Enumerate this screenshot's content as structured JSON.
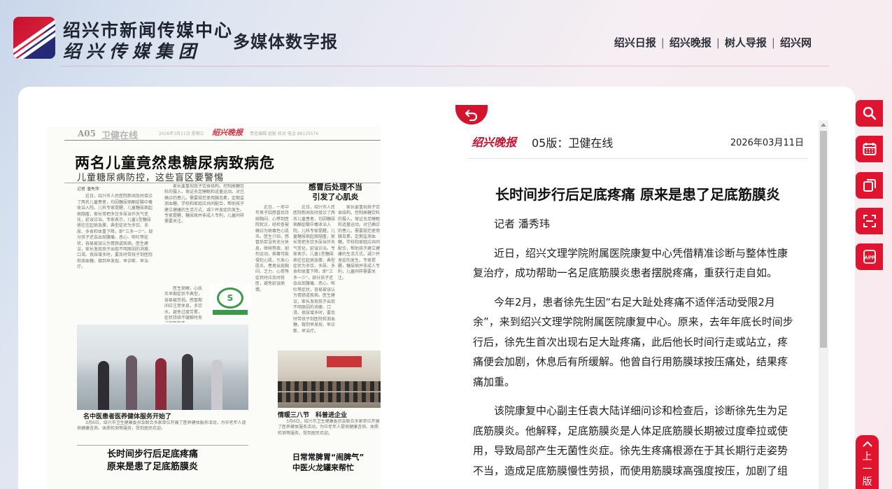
{
  "header": {
    "org_name": "绍兴市新闻传媒中心",
    "org_group": "绍兴传媒集团",
    "site_subtitle": "多媒体数字报",
    "nav": [
      "绍兴日报",
      "绍兴晚报",
      "树人导报",
      "绍兴网"
    ]
  },
  "paper": {
    "page_number": "A05",
    "section": "卫健在线",
    "meta_date": "2026年3月11日 星期三",
    "brand": "绍兴晚报",
    "editor_line": "责任编辑 组版 校对 电话 88125576",
    "main_headline": "两名儿童竟然患糖尿病致病危",
    "sub_headline": "儿童糖尿病防控，这些盲区要警惕",
    "side_headline_1": "感冒后处理不当",
    "side_headline_2": "引发了心肌炎",
    "photo1_caption": "名中医患者医养健体服务开始了",
    "photo2_caption": "情暖三八节　科普进企业",
    "bottom_headline_1a": "长时间步行后足底疼痛",
    "bottom_headline_1b": "原来是患了足底筋膜炎",
    "bottom_headline_2a": "日常常脾胃“闹脾气”",
    "bottom_headline_2b": "中医火龙罐来帮忙",
    "col1_byline": "记者 潘秀萍",
    "col1_text": "近日，绍兴市人民医院新闻及时接诊了两名儿童患者，均因糖尿病酮症酸中毒收治入院。儿科专家提醒，儿童糖尿病起病隐匿，家长常把多饮多尿当作天气变化，延误诊治。专家表示，儿童1型糖尿病往往起病急骤，典型症状为多饮、多尿、多食和体重下降，即“三多一少”。部分孩子还会出现腹痛、恶心、呕吐等症状，容易被误认为胃肠道疾病。医生建议，家长发现孩子出现不明原因的消瘦、口渴、夜尿增多时，要及时带孩子到医院检测血糖，做到早发现、早诊断、早治疗。",
    "col2_text": "家长要重视孩子饮食结构，控制高糖饮料的摄入，保证充足睡眠和适量运动。对已确诊的患儿，需要规范使用胰岛素，定期监测血糖，学校和家庭应共同配合，帮助孩子建立健康的生活方式，减少并发症的发生。专家提醒，糖尿病并非成人专利，儿童同样需要关注。",
    "col3_text": "近日，一名中年男子因感冒后持续胸闷、心悸到医院就诊，经检查被确诊为病毒性心肌炎。医生介绍，感冒后若没有充分休息，继续熬夜、剧烈运动，病毒可能侵犯心肌，引发心肌炎。患者出现胸闷、乏力、心慌等症状时应及时就医，避免延误病情。",
    "col4_text": "医生提醒，心肌炎早期症状不典型，容易被忽视。感冒期间应注意休息，多饮水，避免过度劳累，症状持续不缓解时务必就医检查。",
    "bottom_text": "3月6日，绍兴市卫生健康委员会联合多家单位开展了医养健体服务活动，为中老年人提供健康咨询、体质检测等服务，受到居民欢迎。"
  },
  "article": {
    "brand": "绍兴晚报",
    "edition": "05版：卫健在线",
    "date": "2026年03月11日",
    "title": "长时间步行后足底疼痛 原来是患了足底筋膜炎",
    "paragraphs": [
      "记者 潘秀玮",
      "近日，绍兴文理学院附属医院康复中心凭借精准诊断与整体性康复治疗，成功帮助一名足底筋膜炎患者摆脱疼痛，重获行走自如。",
      "今年2月，患者徐先生因“右足大趾处疼痛不适伴活动受限2月余”，来到绍兴文理学院附属医院康复中心。原来，去年年底长时间步行后，徐先生首次出现右足大趾疼痛，此后他长时间行走或站立，疼痛便会加剧，休息后有所缓解。他曾自行用筋膜球按压痛处，结果疼痛加重。",
      "该院康复中心副主任袁大陆详细问诊和检查后，诊断徐先生为足底筋膜炎。他解释，足底筋膜炎是人体足底筋膜长期被过度牵拉或使用，导致局部产生无菌性炎症。徐先生疼痛根源在于其长期行走姿势不当，造成足底筋膜慢性劳损，而使用筋膜球高强度按压，加剧了组"
    ]
  },
  "tools": [
    "search-icon",
    "calendar-icon",
    "copy-icon",
    "scan-icon",
    "app-icon"
  ],
  "tools_app_label": "APP",
  "prev_page_label": "上一版",
  "colors": {
    "accent": "#e0142e",
    "brand_red": "#c8102e"
  }
}
